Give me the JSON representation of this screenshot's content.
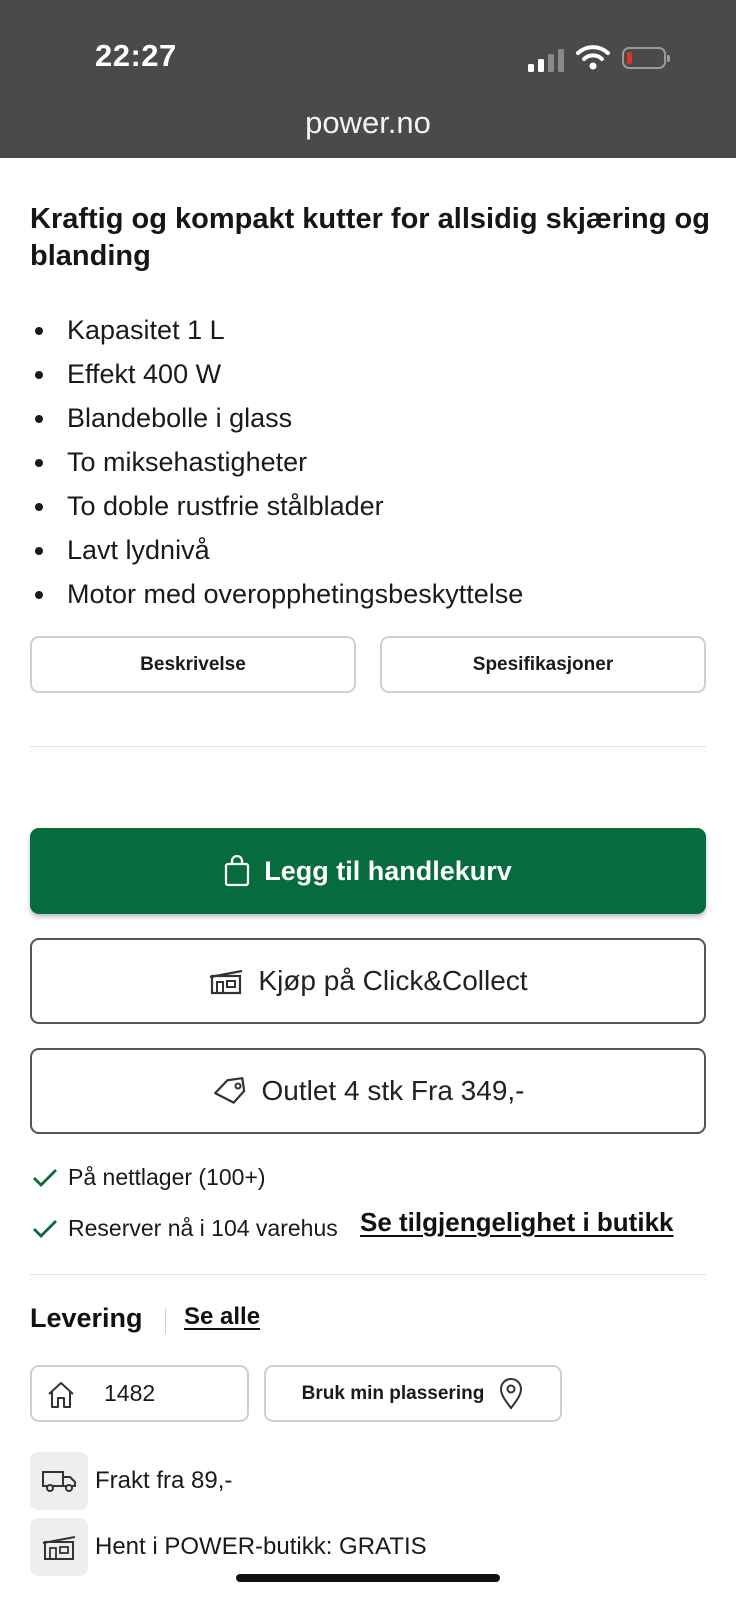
{
  "status_bar": {
    "time": "22:27",
    "url": "power.no"
  },
  "product": {
    "title": "Kraftig og kompakt kutter for allsidig skjæring og blanding",
    "features": [
      "Kapasitet 1 L",
      "Effekt 400 W",
      "Blandebolle i glass",
      "To miksehastigheter",
      "To doble rustfrie stålblader",
      "Lavt lydnivå",
      "Motor med overopphetingsbeskyttelse"
    ]
  },
  "tabs": {
    "description": "Beskrivelse",
    "specifications": "Spesifikasjoner"
  },
  "actions": {
    "add_to_cart": "Legg til handlekurv",
    "click_collect": "Kjøp på Click&Collect",
    "outlet": "Outlet 4 stk Fra 349,-"
  },
  "stock": {
    "online": "På nettlager (100+)",
    "reserve": "Reserver nå i 104 varehus",
    "store_link": "Se tilgjengelighet i butikk"
  },
  "delivery": {
    "title": "Levering",
    "see_all": "Se alle",
    "zip": "1482",
    "use_location": "Bruk min plassering",
    "shipping": "Frakt fra 89,-",
    "pickup": "Hent i POWER-butikk: GRATIS"
  },
  "colors": {
    "primary_green": "#076c3d",
    "status_bar": "#4a4a4a",
    "check_green": "#0f6b3c"
  }
}
